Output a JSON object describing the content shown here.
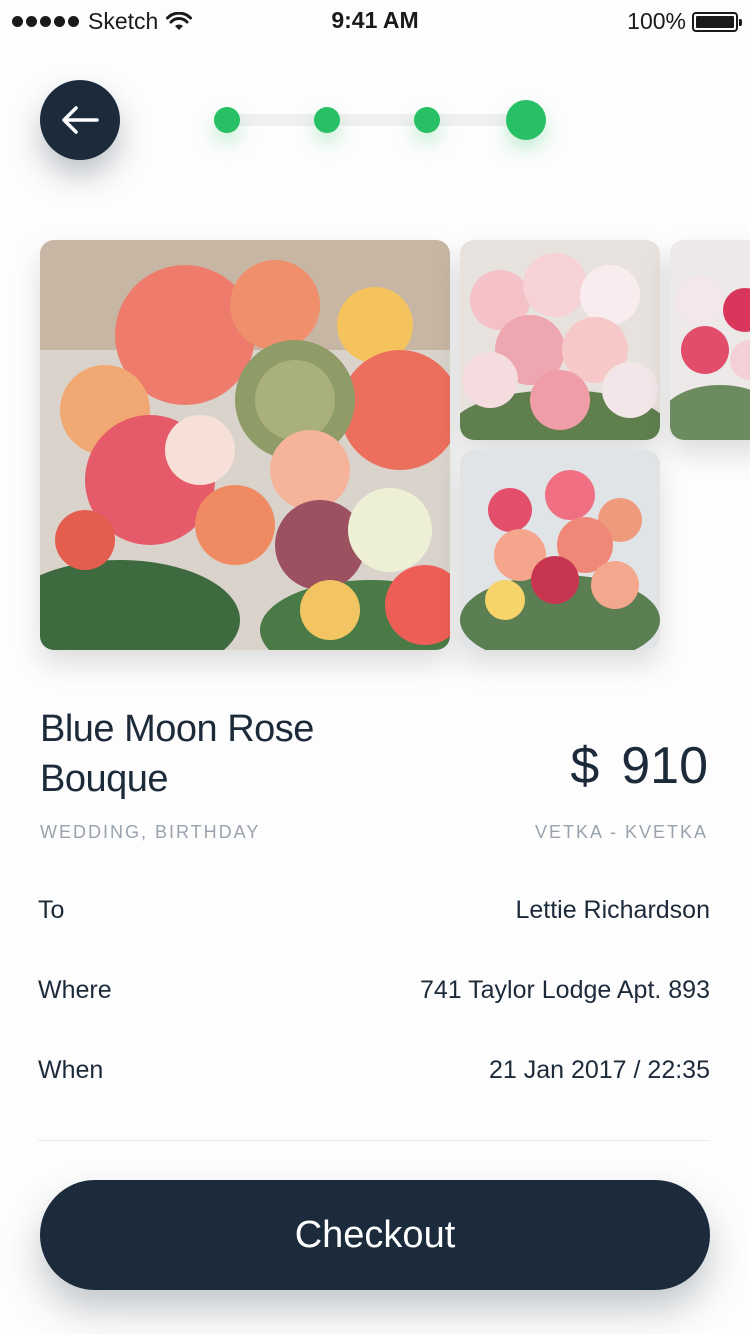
{
  "status_bar": {
    "carrier": "Sketch",
    "time": "9:41 AM",
    "battery": "100%"
  },
  "header": {
    "back_icon": "arrow-left-icon",
    "steps_total": 4,
    "current_step": 4
  },
  "colors": {
    "primary": "#1b2b3c",
    "accent": "#27c065",
    "muted": "#9aa3ad"
  },
  "gallery": {
    "images": [
      "bouquet-main-photo",
      "pink-roses-photo",
      "mixed-bouquet-photo",
      "partial-bouquet-photo"
    ]
  },
  "product": {
    "title_line1": "Blue Moon Rose",
    "title_line2": "Bouque",
    "currency": "$",
    "price": "910",
    "categories": "WEDDING, BIRTHDAY",
    "shop": "VETKA - KVETKA"
  },
  "details": {
    "to_label": "To",
    "to_value": "Lettie Richardson",
    "where_label": "Where",
    "where_value": "741 Taylor Lodge Apt. 893",
    "when_label": "When",
    "when_value": "21 Jan 2017 / 22:35"
  },
  "checkout": {
    "label": "Checkout"
  }
}
